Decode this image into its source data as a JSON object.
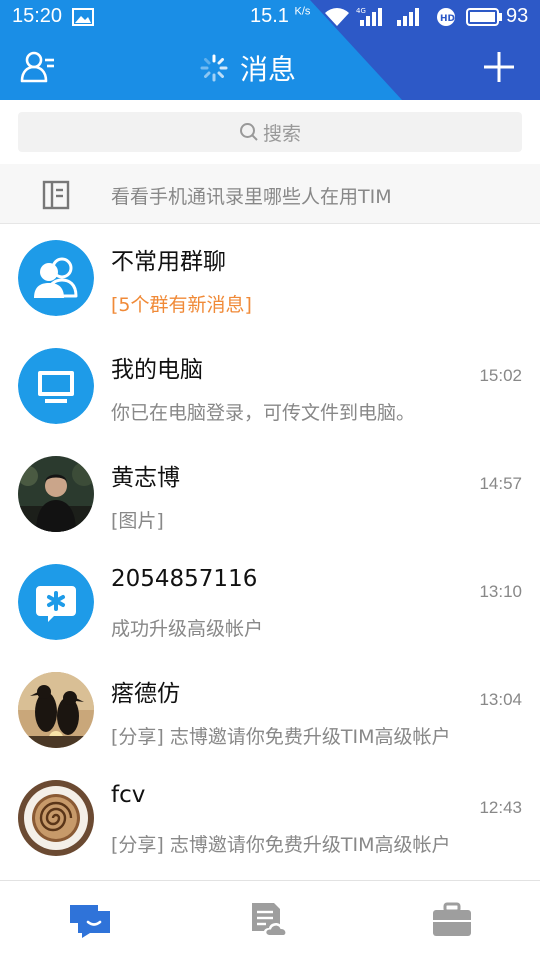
{
  "status_bar": {
    "time": "15:20",
    "speed": "15.1",
    "speed_unit": "K/s",
    "network_label": "4G",
    "battery": "93"
  },
  "nav": {
    "title": "消息"
  },
  "search": {
    "placeholder": "搜索"
  },
  "invite": {
    "text": "看看手机通讯录里哪些人在用TIM"
  },
  "chats": [
    {
      "name": "不常用群聊",
      "time": "",
      "preview": "[5个群有新消息]",
      "avatar": "group-icon"
    },
    {
      "name": "我的电脑",
      "time": "15:02",
      "preview": "你已在电脑登录，可传文件到电脑。",
      "avatar": "monitor-icon"
    },
    {
      "name": "黄志博",
      "time": "14:57",
      "preview": "[图片]",
      "avatar": "user-photo"
    },
    {
      "name": "2054857116",
      "time": "13:10",
      "preview": "成功升级高级帐户",
      "avatar": "service-icon"
    },
    {
      "name": "瘩德仿",
      "time": "13:04",
      "preview": "[分享] 志博邀请你免费升级TIM高级帐户",
      "avatar": "penguins-photo"
    },
    {
      "name": "fcv",
      "time": "12:43",
      "preview": "[分享] 志博邀请你免费升级TIM高级帐户",
      "avatar": "coffee-photo"
    }
  ],
  "tabs": [
    {
      "name": "messages",
      "icon": "chat-bubble-icon",
      "active": true
    },
    {
      "name": "docs",
      "icon": "cloud-document-icon",
      "active": false
    },
    {
      "name": "work",
      "icon": "briefcase-icon",
      "active": false
    }
  ],
  "colors": {
    "header": "#1a8ee6",
    "header_shade": "#2d59c7",
    "avatar_blue": "#1e9be8",
    "highlight": "#f08a38",
    "tab_active": "#2f73d9",
    "tab_inactive": "#9e9e9e"
  }
}
